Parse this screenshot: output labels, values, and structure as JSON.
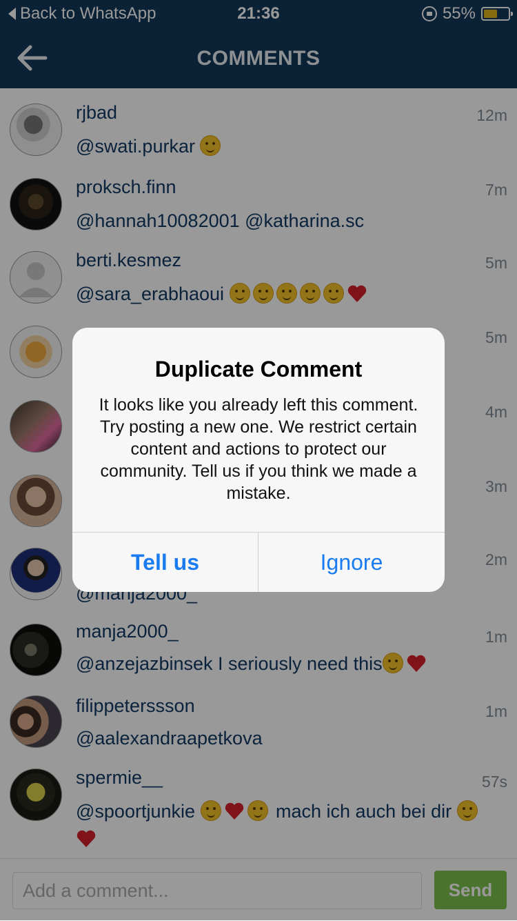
{
  "status_bar": {
    "back_label": "Back to WhatsApp",
    "time": "21:36",
    "battery": "55%",
    "battery_level": 0.55
  },
  "nav": {
    "title": "COMMENTS"
  },
  "comments": [
    {
      "username": "rjbad",
      "text": "@swati.purkar",
      "time": "12m"
    },
    {
      "username": "proksch.finn",
      "text": "@hannah10082001  @katharina.sc",
      "time": "7m"
    },
    {
      "username": "berti.kesmez",
      "text": "@sara_erabhaoui",
      "time": "5m"
    },
    {
      "username": "",
      "text": "",
      "time": "5m"
    },
    {
      "username": "",
      "text": "",
      "time": "4m"
    },
    {
      "username": "",
      "text": "",
      "time": "3m"
    },
    {
      "username": "",
      "text": "@manja2000_",
      "time": "2m"
    },
    {
      "username": "manja2000_",
      "text": "@anzejazbinsek I seriously need this",
      "time": "1m"
    },
    {
      "username": "filippeterssson",
      "text": "@aalexandraapetkova",
      "time": "1m"
    },
    {
      "username": "spermie__",
      "text": "@spoortjunkie",
      "text_suffix": " mach ich auch bei dir",
      "time": "57s"
    }
  ],
  "dialog": {
    "title": "Duplicate Comment",
    "message": "It looks like you already left this comment. Try posting a new one. We restrict certain content and actions to protect our community. Tell us if you think we made a mistake.",
    "tell_us": "Tell us",
    "ignore": "Ignore"
  },
  "comment_bar": {
    "placeholder": "Add a comment...",
    "send": "Send"
  },
  "colors": {
    "nav_bg": "#12375a",
    "link_blue": "#123a65",
    "dialog_button": "#1a7cf0",
    "send_green": "#7cc04b"
  }
}
